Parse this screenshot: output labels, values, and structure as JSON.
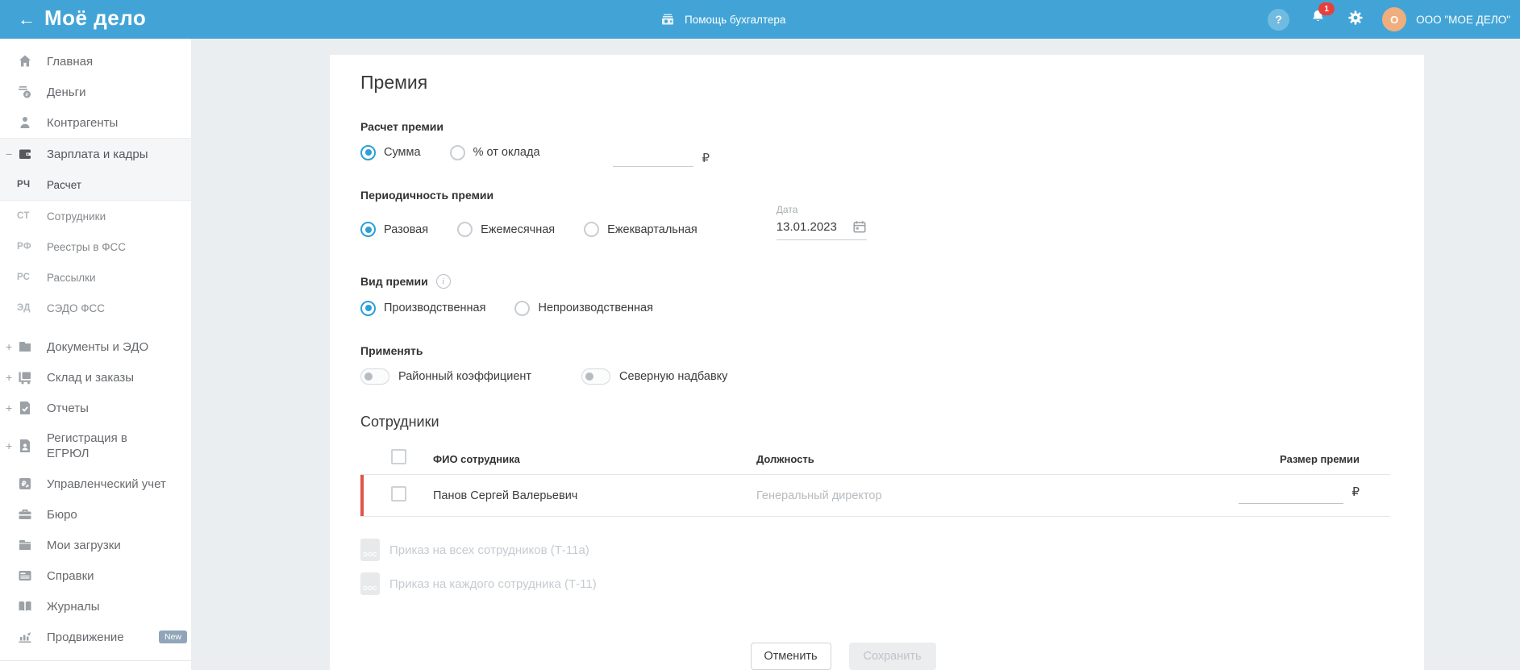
{
  "header": {
    "back_arrow": "←",
    "logo": "Моё дело",
    "help_center": "Помощь бухгалтера",
    "notification_count": "1",
    "avatar_letter": "О",
    "org_name": "ООО \"МОЕ ДЕЛО\""
  },
  "colors": {
    "header_bg": "#42a4d6",
    "radio_selected": "#2d9ed8",
    "row_accent_red": "#e0554a",
    "notification_badge": "#e6403c",
    "avatar_bg": "#f0ad7e",
    "new_badge": "#90a5b9"
  },
  "sidebar": {
    "items": [
      {
        "label": "Главная",
        "icon": "home-icon",
        "type": "section"
      },
      {
        "label": "Деньги",
        "icon": "money-icon",
        "type": "section"
      },
      {
        "label": "Контрагенты",
        "icon": "partners-icon",
        "type": "section"
      },
      {
        "label": "Зарплата и кадры",
        "icon": "salary-icon",
        "type": "section",
        "expander": "−",
        "active": true
      },
      {
        "label": "Расчет",
        "prefix": "РЧ",
        "type": "sub",
        "active": true
      },
      {
        "label": "Сотрудники",
        "prefix": "СТ",
        "type": "sub"
      },
      {
        "label": "Реестры в ФСС",
        "prefix": "РФ",
        "type": "sub"
      },
      {
        "label": "Рассылки",
        "prefix": "РС",
        "type": "sub"
      },
      {
        "label": "СЭДО ФСС",
        "prefix": "ЭД",
        "type": "sub"
      },
      {
        "label": "Документы и ЭДО",
        "icon": "documents-icon",
        "type": "section",
        "expander": "+"
      },
      {
        "label": "Склад и заказы",
        "icon": "warehouse-icon",
        "type": "section",
        "expander": "+"
      },
      {
        "label": "Отчеты",
        "icon": "reports-icon",
        "type": "section",
        "expander": "+"
      },
      {
        "label": "Регистрация в ЕГРЮЛ",
        "icon": "registration-icon",
        "type": "section",
        "expander": "+",
        "twoline": true
      },
      {
        "label": "Управленческий учет",
        "icon": "management-icon",
        "type": "section"
      },
      {
        "label": "Бюро",
        "icon": "bureau-icon",
        "type": "section"
      },
      {
        "label": "Мои загрузки",
        "icon": "downloads-icon",
        "type": "section"
      },
      {
        "label": "Справки",
        "icon": "certificates-icon",
        "type": "section"
      },
      {
        "label": "Журналы",
        "icon": "journals-icon",
        "type": "section"
      },
      {
        "label": "Продвижение",
        "icon": "promotion-icon",
        "type": "section",
        "badge": "New"
      }
    ]
  },
  "page": {
    "title": "Премия",
    "sections": {
      "calc": {
        "label": "Расчет премии",
        "options": [
          {
            "label": "Сумма",
            "selected": true
          },
          {
            "label": "% от оклада",
            "selected": false
          }
        ],
        "amount_value": "",
        "currency": "₽"
      },
      "period": {
        "label": "Периодичность премии",
        "options": [
          {
            "label": "Разовая",
            "selected": true
          },
          {
            "label": "Ежемесячная",
            "selected": false
          },
          {
            "label": "Ежеквартальная",
            "selected": false
          }
        ],
        "date_label": "Дата",
        "date_value": "13.01.2023"
      },
      "kind": {
        "label": "Вид премии",
        "options": [
          {
            "label": "Производственная",
            "selected": true
          },
          {
            "label": "Непроизводственная",
            "selected": false
          }
        ]
      },
      "apply": {
        "label": "Применять",
        "toggles": [
          {
            "label": "Районный коэффициент",
            "on": false
          },
          {
            "label": "Северную надбавку",
            "on": false
          }
        ]
      }
    },
    "employees": {
      "title": "Сотрудники",
      "columns": [
        "ФИО сотрудника",
        "Должность",
        "Размер премии"
      ],
      "rows": [
        {
          "name": "Панов Сергей Валерьевич",
          "position": "Генеральный директор",
          "amount": "",
          "currency": "₽"
        }
      ]
    },
    "doc_links": [
      {
        "label": "Приказ на всех сотрудников (Т-11а)",
        "badge": "DOC"
      },
      {
        "label": "Приказ на каждого сотрудника (Т-11)",
        "badge": "DOC"
      }
    ],
    "buttons": {
      "cancel": "Отменить",
      "save": "Сохранить"
    }
  }
}
